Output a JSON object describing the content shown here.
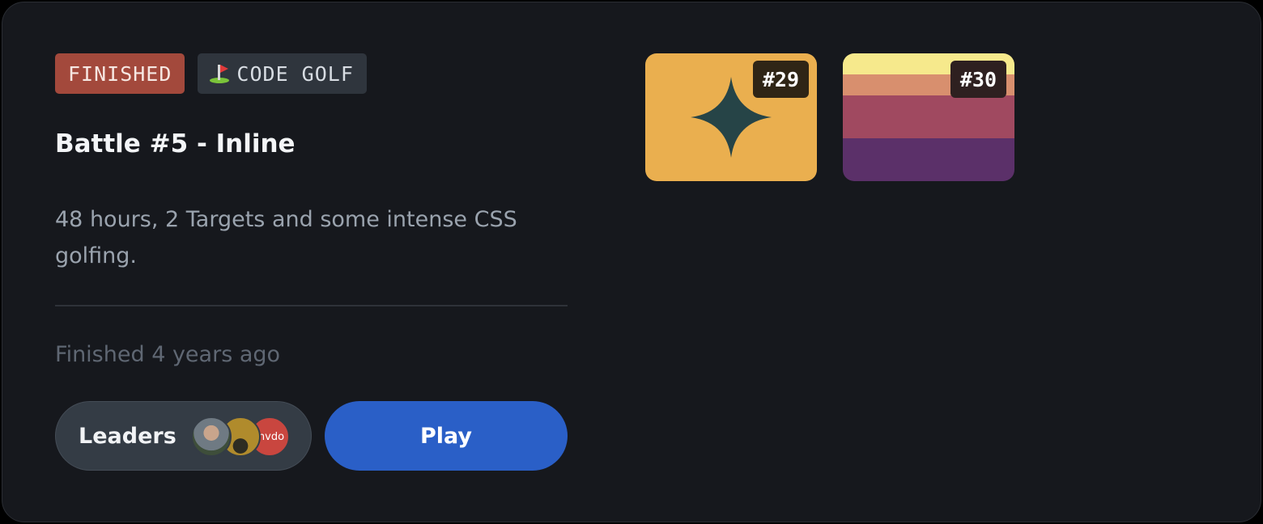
{
  "tags": {
    "status": "FINISHED",
    "category": "CODE GOLF"
  },
  "battle": {
    "title": "Battle #5 - Inline",
    "description": "48 hours, 2 Targets and some intense CSS golfing.",
    "finished_text": "Finished 4 years ago"
  },
  "actions": {
    "leaders_label": "Leaders",
    "play_label": "Play"
  },
  "avatars": [
    {
      "name": "leader-avatar-1"
    },
    {
      "name": "leader-avatar-2"
    },
    {
      "name": "leader-avatar-3",
      "text": "nvdo"
    }
  ],
  "targets": [
    {
      "number": "#29",
      "background": "#eaaf4f",
      "shape": "four-point-star",
      "shape_color": "#264447"
    },
    {
      "number": "#30",
      "stripes": [
        "#f6e98c",
        "#d88f6e",
        "#a04960",
        "#5b3069"
      ]
    }
  ],
  "colors": {
    "card_bg": "#16181d",
    "finished_tag": "#a3493c",
    "golf_tag": "#2f353d",
    "play_button": "#2a5fc7",
    "leaders_button": "#343c45"
  }
}
